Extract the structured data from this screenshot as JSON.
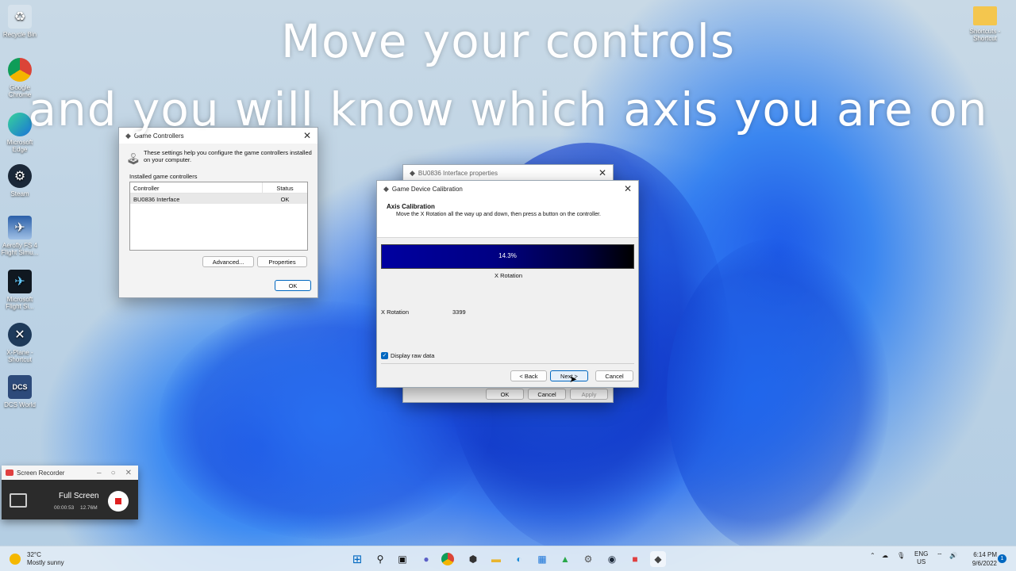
{
  "caption": {
    "line1": "Move your controls",
    "line2": "and you will know which axis you are on"
  },
  "desktop_icons": [
    {
      "label": "Recycle Bin",
      "icon": "recycle-bin-icon"
    },
    {
      "label": "Google Chrome",
      "icon": "chrome-icon"
    },
    {
      "label": "Microsoft Edge",
      "icon": "edge-icon"
    },
    {
      "label": "Steam",
      "icon": "steam-icon"
    },
    {
      "label": "Aerofly FS 4 Flight Simu...",
      "icon": "aerofly-icon"
    },
    {
      "label": "Microsoft Flight Si...",
      "icon": "msfs-icon"
    },
    {
      "label": "X-Plane - Shortcut",
      "icon": "xplane-icon"
    },
    {
      "label": "DCS World",
      "icon": "dcs-icon"
    },
    {
      "label": "Shortcuts - Shortcut",
      "icon": "folder-icon"
    }
  ],
  "game_controllers": {
    "title": "Game Controllers",
    "description": "These settings help you configure the game controllers installed on your computer.",
    "list_label": "Installed game controllers",
    "columns": [
      "Controller",
      "Status"
    ],
    "rows": [
      {
        "controller": "BU0836 Interface",
        "status": "OK"
      }
    ],
    "advanced_label": "Advanced...",
    "properties_label": "Properties",
    "ok_label": "OK"
  },
  "properties_window": {
    "title": "BU0836 Interface properties",
    "ok_label": "OK",
    "cancel_label": "Cancel",
    "apply_label": "Apply"
  },
  "calibration": {
    "title": "Game Device Calibration",
    "heading": "Axis Calibration",
    "instruction": "Move the X Rotation all the way up and down, then press a button on the controller.",
    "percent_text": "14.3%",
    "progress_fraction": 0.143,
    "axis_name": "X Rotation",
    "raw_label": "X Rotation",
    "raw_value": "3399",
    "display_raw_label": "Display raw data",
    "display_raw_checked": true,
    "back_label": "< Back",
    "next_label": "Next >",
    "cancel_label": "Cancel"
  },
  "recorder": {
    "title": "Screen Recorder",
    "mode": "Full Screen",
    "time": "00:00:53",
    "size": "12.76M"
  },
  "taskbar": {
    "temperature": "32°C",
    "weather": "Mostly sunny",
    "language": "ENG",
    "region": "US",
    "time": "6:14 PM",
    "date": "9/6/2022",
    "notifications": "1"
  },
  "colors": {
    "accent": "#0067c0",
    "progress_fill": "#0000d8",
    "recorder_bg": "#2b2b2b"
  }
}
